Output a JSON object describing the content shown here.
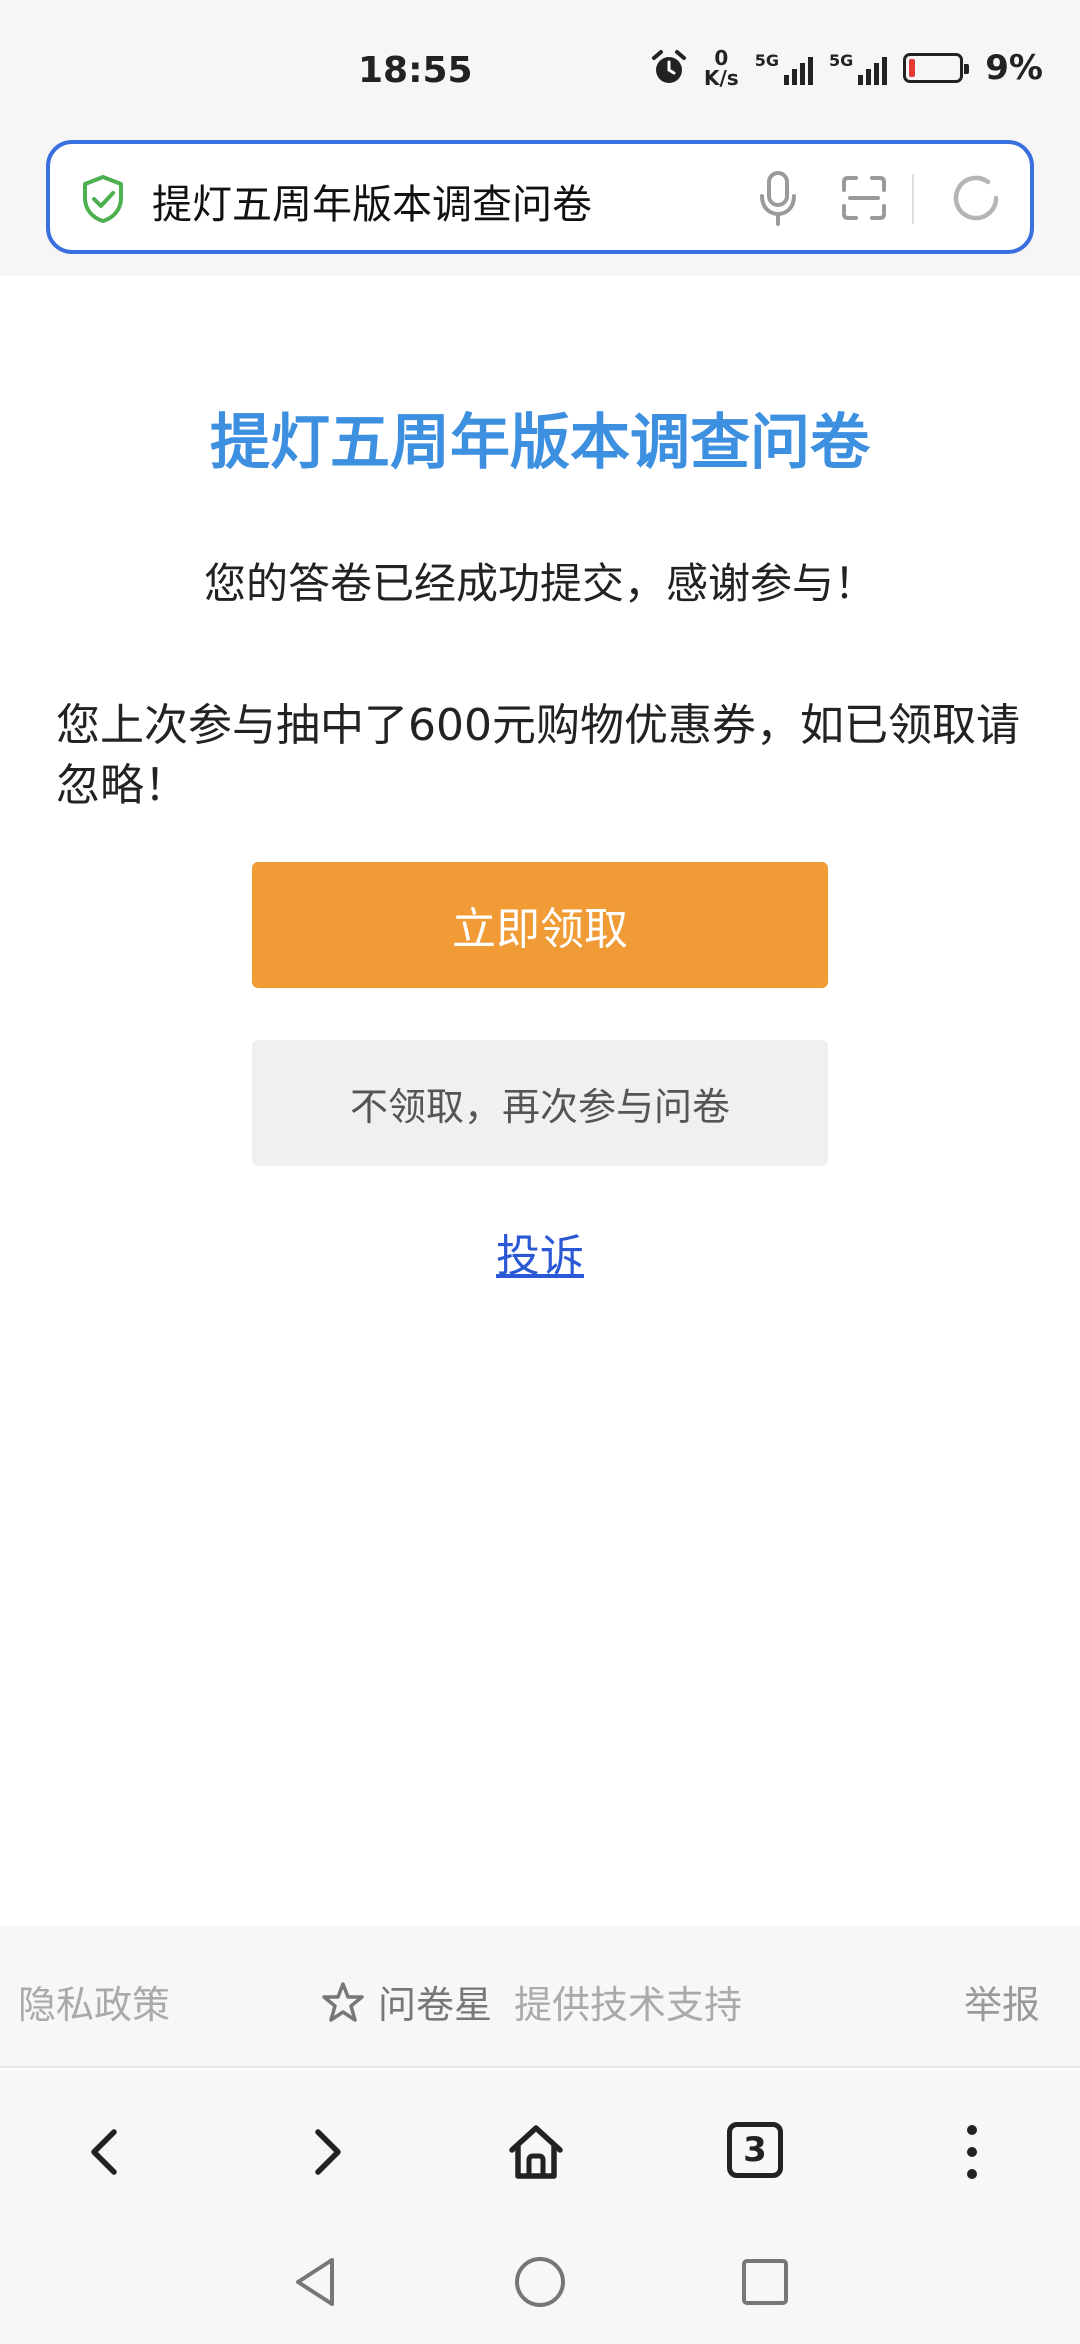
{
  "status_bar": {
    "time": "18:55",
    "net_speed_value": "0",
    "net_speed_unit": "K/s",
    "signal_1_label": "5G",
    "signal_2_label": "5G",
    "battery_percent": "9%",
    "battery_level": 0.09,
    "battery_color": "#e53935"
  },
  "address_bar": {
    "text": "提灯五周年版本调查问卷",
    "border_color": "#3a6fe0",
    "icons": [
      "shield-check-icon",
      "mic-icon",
      "scan-icon",
      "refresh-icon"
    ]
  },
  "main": {
    "title": "提灯五周年版本调查问卷",
    "title_color": "#3d8fe0",
    "submit_message": "您的答卷已经成功提交，感谢参与！",
    "coupon_message": "您上次参与抽中了600元购物优惠券，如已领取请忽略！",
    "claim_button_label": "立即领取",
    "claim_button_color": "#f09b36",
    "retake_button_label": "不领取，再次参与问卷",
    "complain_link": "投诉"
  },
  "footer": {
    "privacy": "隐私政策",
    "brand_name": "问卷星",
    "tech_support": "提供技术支持",
    "report": "举报"
  },
  "browser_nav": {
    "tabs_count": "3",
    "icons": [
      "back-icon",
      "forward-icon",
      "home-icon",
      "tabs-icon",
      "more-icon"
    ]
  },
  "system_nav": {
    "icons": [
      "back-triangle-icon",
      "home-circle-icon",
      "recents-square-icon"
    ]
  }
}
